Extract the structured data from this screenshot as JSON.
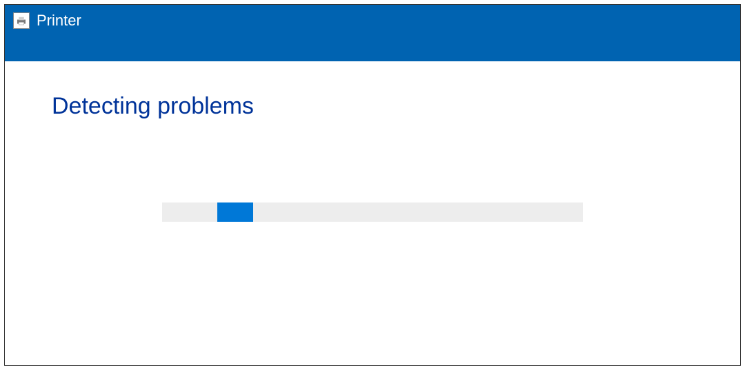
{
  "titlebar": {
    "title": "Printer",
    "icon_name": "printer-troubleshooter-icon"
  },
  "main": {
    "heading": "Detecting problems"
  },
  "progress": {
    "indeterminate": true,
    "indicator_offset_percent": 11,
    "indicator_width_percent": 7
  },
  "colors": {
    "titlebar_bg": "#0063b1",
    "heading_text": "#003399",
    "progress_track": "#ededed",
    "progress_indicator": "#0078d7"
  }
}
